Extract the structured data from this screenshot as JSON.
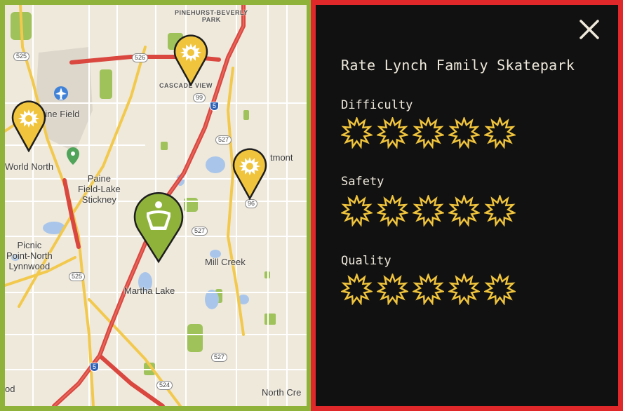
{
  "map": {
    "labels": {
      "pinehurst": "PINEHURST-BEVERLY\nPARK",
      "cascade_view": "CASCADE VIEW",
      "paine_field": "aine Field",
      "world_north": "World North",
      "paine_field_lake_stickney": "Paine\nField-Lake\nStickney",
      "picnic_point": "Picnic\nPoint-North\nLynnwood",
      "martha_lake": "Martha Lake",
      "mill_creek": "Mill Creek",
      "north_creek": "North Cre",
      "mont": "tmont",
      "od": "od"
    },
    "shields": {
      "r525_top": "525",
      "r526": "526",
      "r99": "99",
      "i5_top": "5",
      "r527_a": "527",
      "r96": "96",
      "r527_b": "527",
      "r525_bottom": "525",
      "i5_bottom": "5",
      "r527_c": "527",
      "r524": "524"
    },
    "colors": {
      "border": "#8fb33a",
      "pin_yellow": "#f0c43c",
      "pin_green": "#8fb33a",
      "highway": "#d9473f",
      "land": "#efe9dc",
      "park": "#9fc25b"
    },
    "pins": [
      {
        "name": "skatepark-pin-cascade-view",
        "type": "sun-icon"
      },
      {
        "name": "skatepark-pin-paine-field",
        "type": "sun-icon"
      },
      {
        "name": "skatepark-pin-mont",
        "type": "sun-icon"
      },
      {
        "name": "skatepark-pin-lynch-family-selected",
        "type": "skatepark-icon"
      }
    ]
  },
  "panel": {
    "title": "Rate Lynch Family Skatepark",
    "close_icon": "close-icon",
    "border_color": "#e0282b",
    "star_color": "#f0c43c",
    "categories": [
      {
        "label": "Difficulty",
        "rating": 0,
        "max": 5
      },
      {
        "label": "Safety",
        "rating": 0,
        "max": 5
      },
      {
        "label": "Quality",
        "rating": 0,
        "max": 5
      }
    ]
  }
}
